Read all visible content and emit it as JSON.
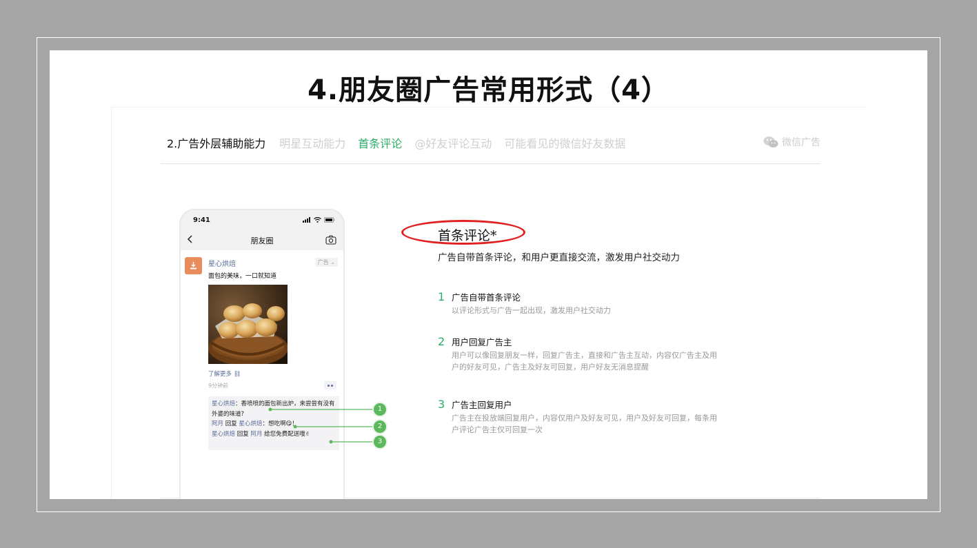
{
  "slide": {
    "title": "4.朋友圈广告常用形式（4）"
  },
  "tabs": {
    "items": [
      "2.广告外层辅助能力",
      "明星互动能力",
      "首条评论",
      "@好友评论互动",
      "可能看见的微信好友数据"
    ]
  },
  "brand": {
    "label": "微信广告"
  },
  "phone": {
    "time": "9:41",
    "nav_title": "朋友圈",
    "author": "星心烘焙",
    "ad_tag": "广告",
    "post_text": "面包的美味，一口就知道",
    "learn_more": "了解更多",
    "time_ago": "9分钟前",
    "comments": [
      {
        "name": "星心烘焙",
        "text": "：香喷喷的面包新出炉，来尝尝有没有外婆的味道?"
      },
      {
        "name": "阿月",
        "reply_word": " 回复 ",
        "target": "星心烘焙",
        "text": "：想吃啊😋！"
      },
      {
        "name": "星心烘焙",
        "reply_word": " 回复 ",
        "target": "阿月",
        "text": " 给您免费配送哦✌"
      }
    ]
  },
  "callouts": [
    "1",
    "2",
    "3"
  ],
  "feature": {
    "title": "首条评论*",
    "subtitle": "广告自带首条评论，和用户更直接交流，激发用户社交动力",
    "points": [
      {
        "num": "1",
        "title": "广告自带首条评论",
        "desc": "以评论形式与广告一起出现，激发用户社交动力"
      },
      {
        "num": "2",
        "title": "用户回复广告主",
        "desc": "用户可以像回复朋友一样，回复广告主，直接和广告主互动，内容仅广告主及用户的好友可见，广告主及好友可回复，用户好友无消息提醒"
      },
      {
        "num": "3",
        "title": "广告主回复用户",
        "desc": "广告主在投放端回复用户，内容仅用户及好友可见，用户及好友可回复，每条用户评论广告主仅可回复一次"
      }
    ]
  },
  "colors": {
    "accent_green": "#2aae67",
    "highlight_red": "#e02020",
    "link_blue": "#576b95",
    "background_gray": "#a6a6a6"
  }
}
